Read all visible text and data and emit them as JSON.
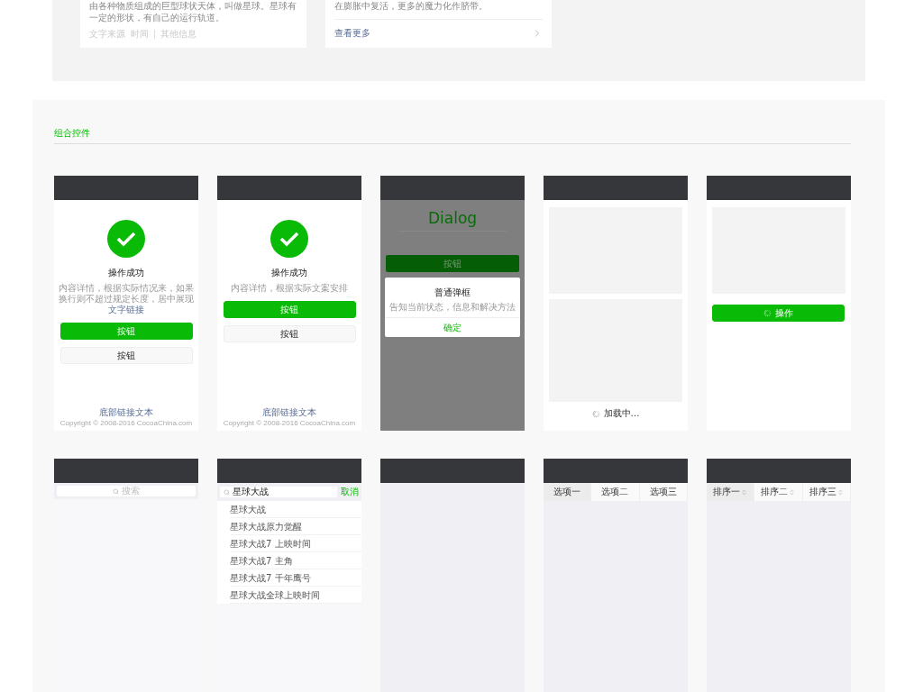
{
  "top_cards": [
    {
      "kind": "article",
      "body": "由各种物质组成的巨型球状天体，叫做星球。星球有一定的形状，有自己的运行轨道。",
      "meta": [
        "文字来源",
        "时间",
        "其他信息"
      ]
    },
    {
      "kind": "more",
      "body": "在膨胀中复活，更多的魔力化作脐带。",
      "link": "查看更多"
    }
  ],
  "section": {
    "title": "组合控件"
  },
  "phones": [
    {
      "kind": "result",
      "title": "操作成功",
      "desc": "内容详情，根据实际情况来，如果换行则不超过规定长度，居中展现",
      "desc_link": "文字链接",
      "primary": "按钮",
      "secondary": "按钮",
      "footer_link": "底部链接文本",
      "copyright": "Copyright © 2008-2016 CocoaChina.com"
    },
    {
      "kind": "result",
      "title": "操作成功",
      "desc": "内容详情，根据实际文案安排",
      "primary": "按钮",
      "secondary": "按钮",
      "footer_link": "底部链接文本",
      "copyright": "Copyright © 2008-2016 CocoaChina.com"
    },
    {
      "kind": "dialog",
      "heading": "Dialog",
      "button": "按钮",
      "dialog_title": "普通弹框",
      "dialog_desc": "告知当前状态，信息和解决方法",
      "confirm": "确定"
    },
    {
      "kind": "loading",
      "text": "加载中…"
    },
    {
      "kind": "button_loading",
      "button": "操作"
    },
    {
      "kind": "search",
      "placeholder": "搜索"
    },
    {
      "kind": "search_active",
      "value": "星球大战",
      "cancel": "取消",
      "results": [
        "星球大战",
        "星球大战原力觉醒",
        "星球大战7 上映时间",
        "星球大战7 主角",
        "星球大战7 千年鹰号",
        "星球大战全球上映时间"
      ]
    },
    {
      "kind": "blank"
    },
    {
      "kind": "tabs",
      "tabs": [
        {
          "label": "选项一",
          "selected": true
        },
        {
          "label": "选项二",
          "selected": false
        },
        {
          "label": "选项三",
          "selected": false
        }
      ]
    },
    {
      "kind": "sort",
      "tabs": [
        {
          "label": "排序一",
          "selected": true
        },
        {
          "label": "排序二",
          "selected": false
        },
        {
          "label": "排序三",
          "selected": false
        }
      ]
    }
  ]
}
